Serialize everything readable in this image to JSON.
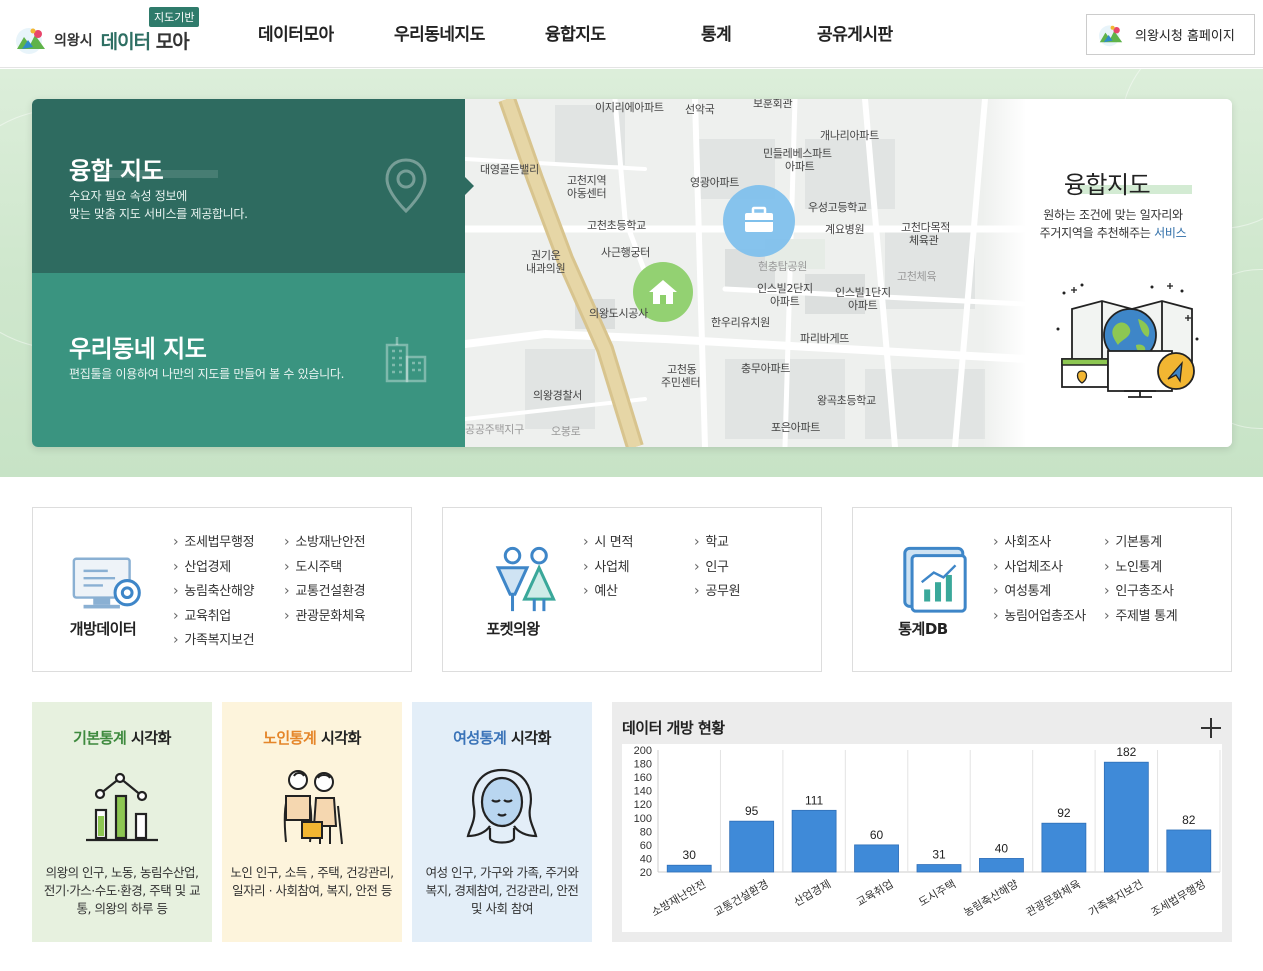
{
  "header": {
    "logo_city": "의왕시",
    "logo_title_1": "데이터",
    "logo_title_2": "모아",
    "logo_badge": "지도기반",
    "nav": [
      "데이터모아",
      "우리동네지도",
      "융합지도",
      "통계",
      "공유게시판"
    ],
    "home_button": "의왕시청 홈페이지"
  },
  "hero": {
    "panels": [
      {
        "title": "융합 지도",
        "desc_line1": "수요자 필요 속성 정보에",
        "desc_line2": "맞는 맞춤 지도 서비스를 제공합니다.",
        "icon": "map-pin-icon"
      },
      {
        "title": "우리동네 지도",
        "desc_line1": "편집툴을 이용하여 나만의 지도를 만들어 볼 수 있습니다.",
        "icon": "building-icon"
      }
    ],
    "map_labels": [
      "이지리에아파트",
      "선악국",
      "보훈회관",
      "개나리아파트",
      "민들레베스파트",
      "아파트",
      "대영골든밸리",
      "고천지역",
      "아동센터",
      "영광아파트",
      "우성고등학교",
      "고천초등학교",
      "계요병원",
      "고천다목적",
      "체육관",
      "권기운",
      "내과의원",
      "사근행궁터",
      "현충탑공원",
      "고천체육",
      "인스빌2단지",
      "아파트",
      "인스빌1단지",
      "아파트",
      "의왕도시공사",
      "한우리유치원",
      "파리바게뜨",
      "고천동",
      "주민센터",
      "충무아파트",
      "의왕경찰서",
      "왕곡초등학교",
      "공공주택지구",
      "포은아파트",
      "오봉로"
    ],
    "right_title": "융합지도",
    "right_desc_line1": "원하는 조건에 맞는 일자리와",
    "right_desc_line2": "주거지역을 추천해주는",
    "right_desc_hl": "서비스"
  },
  "quick": [
    {
      "title": "개방데이터",
      "icon": "monitor-gear-icon",
      "links": [
        "조세법무행정",
        "소방재난안전",
        "산업경제",
        "도시주택",
        "농림축산해양",
        "교통건설환경",
        "교육취업",
        "관광문화체육",
        "가족복지보건"
      ]
    },
    {
      "title": "포켓의왕",
      "icon": "people-icon",
      "links": [
        "시 면적",
        "학교",
        "사업체",
        "인구",
        "예산",
        "공무원"
      ]
    },
    {
      "title": "통계DB",
      "icon": "chart-board-icon",
      "links": [
        "사회조사",
        "기본통계",
        "사업체조사",
        "노인통계",
        "여성통계",
        "인구총조사",
        "농림어업총조사",
        "주제별 통계"
      ]
    }
  ],
  "viz": [
    {
      "title_hl": "기본통계",
      "title_rest": " 시각화",
      "desc": "의왕의 인구, 노동, 농림수산업, 전기·가스·수도·환경, 주택 및 교통, 의왕의 하루 등",
      "bg": "#e7f1df",
      "hl": "#3e8a3e",
      "icon": "bar-line-icon"
    },
    {
      "title_hl": "노인통계",
      "title_rest": " 시각화",
      "desc": "노인 인구, 소득 , 주택, 건강관리, 일자리 · 사회참여, 복지, 안전 등",
      "bg": "#fdf4dc",
      "hl": "#e5862a",
      "icon": "elderly-icon"
    },
    {
      "title_hl": "여성통계",
      "title_rest": " 시각화",
      "desc": "여성 인구, 가구와 가족, 주거와 복지, 경제참여, 건강관리, 안전 및 사회 참여",
      "bg": "#e3eef8",
      "hl": "#3a73b8",
      "icon": "woman-icon"
    }
  ],
  "chart_title": "데이터 개방 현황",
  "chart_data": {
    "type": "bar",
    "categories": [
      "소방재난안전",
      "교통건설환경",
      "산업경제",
      "교육취업",
      "도시주택",
      "농림축산해양",
      "관광문화체육",
      "가족복지보건",
      "조세법무행정"
    ],
    "values": [
      30,
      95,
      111,
      60,
      31,
      40,
      92,
      182,
      82
    ],
    "ylim": [
      20,
      200
    ],
    "yticks": [
      200,
      180,
      160,
      140,
      120,
      100,
      80,
      60,
      40,
      20
    ],
    "grid": true,
    "bar_color": "#3f8ad8"
  }
}
